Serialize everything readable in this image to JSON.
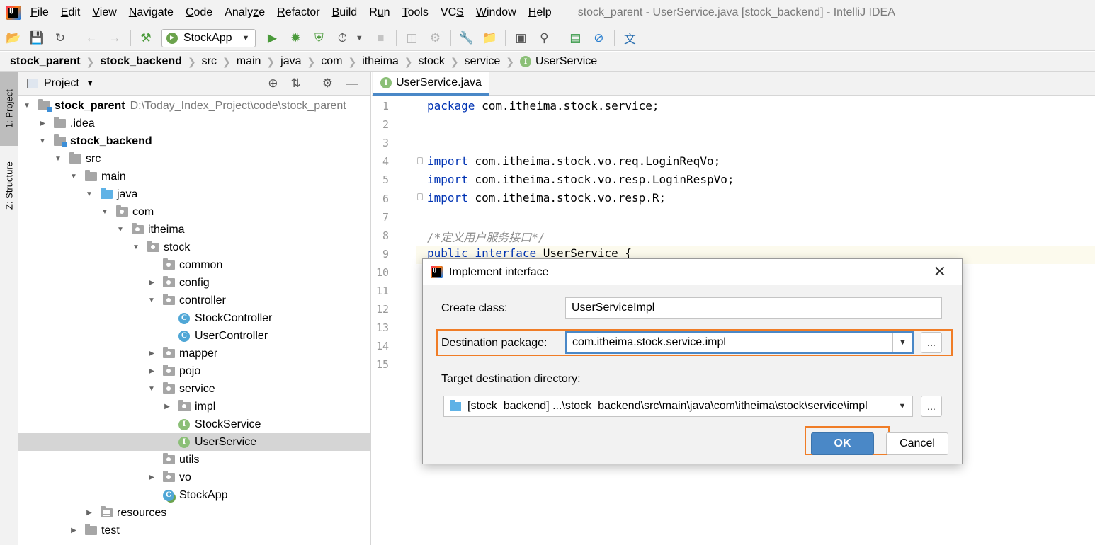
{
  "window": {
    "title": "stock_parent - UserService.java [stock_backend] - IntelliJ IDEA"
  },
  "menu": {
    "items": [
      "File",
      "Edit",
      "View",
      "Navigate",
      "Code",
      "Analyze",
      "Refactor",
      "Build",
      "Run",
      "Tools",
      "VCS",
      "Window",
      "Help"
    ],
    "mnemonics": [
      "F",
      "E",
      "V",
      "N",
      "C",
      "z",
      "R",
      "B",
      "u",
      "T",
      "S",
      "W",
      "H"
    ]
  },
  "toolbar": {
    "run_config": "StockApp",
    "icons": [
      "open-folder-icon",
      "save-icon",
      "sync-icon",
      "back-arrow-icon",
      "forward-arrow-icon",
      "build-hammer-icon",
      "run-icon",
      "debug-icon",
      "coverage-icon",
      "profile-icon",
      "stop-icon",
      "attach-icon",
      "deploy-icon",
      "settings-wrench-icon",
      "project-structure-icon",
      "terminal-icon",
      "search-icon",
      "activity-icon",
      "disable-icon",
      "translate-icon"
    ]
  },
  "breadcrumb": {
    "items": [
      "stock_parent",
      "stock_backend",
      "src",
      "main",
      "java",
      "com",
      "itheima",
      "stock",
      "service",
      "UserService"
    ]
  },
  "tool_stripe": {
    "project_tab": "1: Project",
    "structure_tab": "Z: Structure"
  },
  "project_panel": {
    "title": "Project",
    "tree": [
      {
        "label": "stock_parent",
        "path": "D:\\Today_Index_Project\\code\\stock_parent",
        "indent": 0,
        "arrow": "down",
        "icon": "module",
        "bold": true
      },
      {
        "label": ".idea",
        "indent": 1,
        "arrow": "right",
        "icon": "folder"
      },
      {
        "label": "stock_backend",
        "indent": 1,
        "arrow": "down",
        "icon": "module",
        "bold": true
      },
      {
        "label": "src",
        "indent": 2,
        "arrow": "down",
        "icon": "folder"
      },
      {
        "label": "main",
        "indent": 3,
        "arrow": "down",
        "icon": "folder"
      },
      {
        "label": "java",
        "indent": 4,
        "arrow": "down",
        "icon": "source"
      },
      {
        "label": "com",
        "indent": 5,
        "arrow": "down",
        "icon": "package"
      },
      {
        "label": "itheima",
        "indent": 6,
        "arrow": "down",
        "icon": "package"
      },
      {
        "label": "stock",
        "indent": 7,
        "arrow": "down",
        "icon": "package"
      },
      {
        "label": "common",
        "indent": 8,
        "arrow": "none",
        "icon": "package"
      },
      {
        "label": "config",
        "indent": 8,
        "arrow": "right",
        "icon": "package"
      },
      {
        "label": "controller",
        "indent": 8,
        "arrow": "down",
        "icon": "package"
      },
      {
        "label": "StockController",
        "indent": 9,
        "arrow": "none",
        "icon": "class"
      },
      {
        "label": "UserController",
        "indent": 9,
        "arrow": "none",
        "icon": "class"
      },
      {
        "label": "mapper",
        "indent": 8,
        "arrow": "right",
        "icon": "package"
      },
      {
        "label": "pojo",
        "indent": 8,
        "arrow": "right",
        "icon": "package"
      },
      {
        "label": "service",
        "indent": 8,
        "arrow": "down",
        "icon": "package"
      },
      {
        "label": "impl",
        "indent": 9,
        "arrow": "right",
        "icon": "package"
      },
      {
        "label": "StockService",
        "indent": 9,
        "arrow": "none",
        "icon": "interface"
      },
      {
        "label": "UserService",
        "indent": 9,
        "arrow": "none",
        "icon": "interface",
        "selected": true
      },
      {
        "label": "utils",
        "indent": 8,
        "arrow": "none",
        "icon": "package"
      },
      {
        "label": "vo",
        "indent": 8,
        "arrow": "right",
        "icon": "package"
      },
      {
        "label": "StockApp",
        "indent": 8,
        "arrow": "none",
        "icon": "app"
      },
      {
        "label": "resources",
        "indent": 4,
        "arrow": "right",
        "icon": "resources"
      },
      {
        "label": "test",
        "indent": 3,
        "arrow": "right",
        "icon": "folder"
      }
    ]
  },
  "editor": {
    "tab_label": "UserService.java",
    "line_numbers": [
      "1",
      "2",
      "3",
      "4",
      "5",
      "6",
      "7",
      "8",
      "9",
      "10",
      "11",
      "12",
      "13",
      "14",
      "15"
    ],
    "code": {
      "l1_kw": "package",
      "l1_rest": " com.itheima.stock.service;",
      "l4_kw": "import",
      "l4_rest": " com.itheima.stock.vo.req.LoginReqVo;",
      "l5_kw": "import",
      "l5_rest": " com.itheima.stock.vo.resp.LoginRespVo;",
      "l6_kw": "import",
      "l6_rest": " com.itheima.stock.vo.resp.R;",
      "l8_comment": "/*定义用户服务接口*/",
      "l9_kw": "public interface",
      "l9_rest": " UserService {"
    }
  },
  "dialog": {
    "title": "Implement interface",
    "create_class_label": "Create class:",
    "create_class_value": "UserServiceImpl",
    "destination_package_label": "Destination package:",
    "destination_package_value": "com.itheima.stock.service.impl",
    "browse_label": "...",
    "target_dir_label": "Target destination directory:",
    "target_dir_value": "[stock_backend] ...\\stock_backend\\src\\main\\java\\com\\itheima\\stock\\service\\impl",
    "ok_label": "OK",
    "cancel_label": "Cancel",
    "close_glyph": "✕",
    "highlight_color": "#f07d27",
    "accent_color": "#4a88c7"
  }
}
